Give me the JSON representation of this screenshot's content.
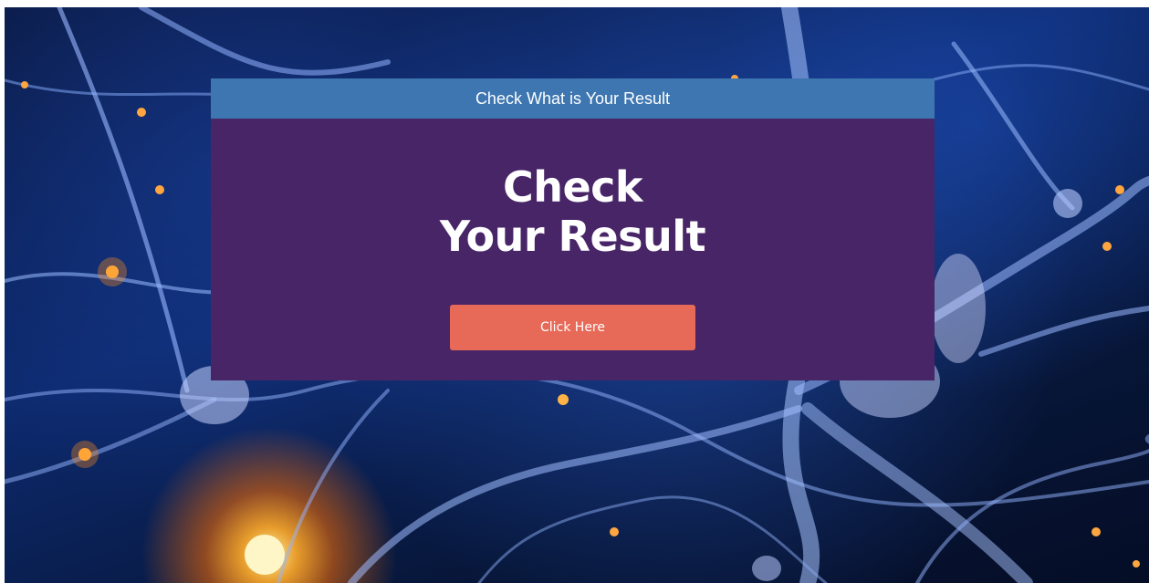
{
  "banner": {
    "title": "Check What is Your Result"
  },
  "hero": {
    "line1": "Check",
    "line2": "Your Result",
    "button_label": "Click Here"
  },
  "colors": {
    "card_background": "#472567",
    "header_background": "#3d76b1",
    "button_background": "#e76a58",
    "text": "#ffffff"
  }
}
